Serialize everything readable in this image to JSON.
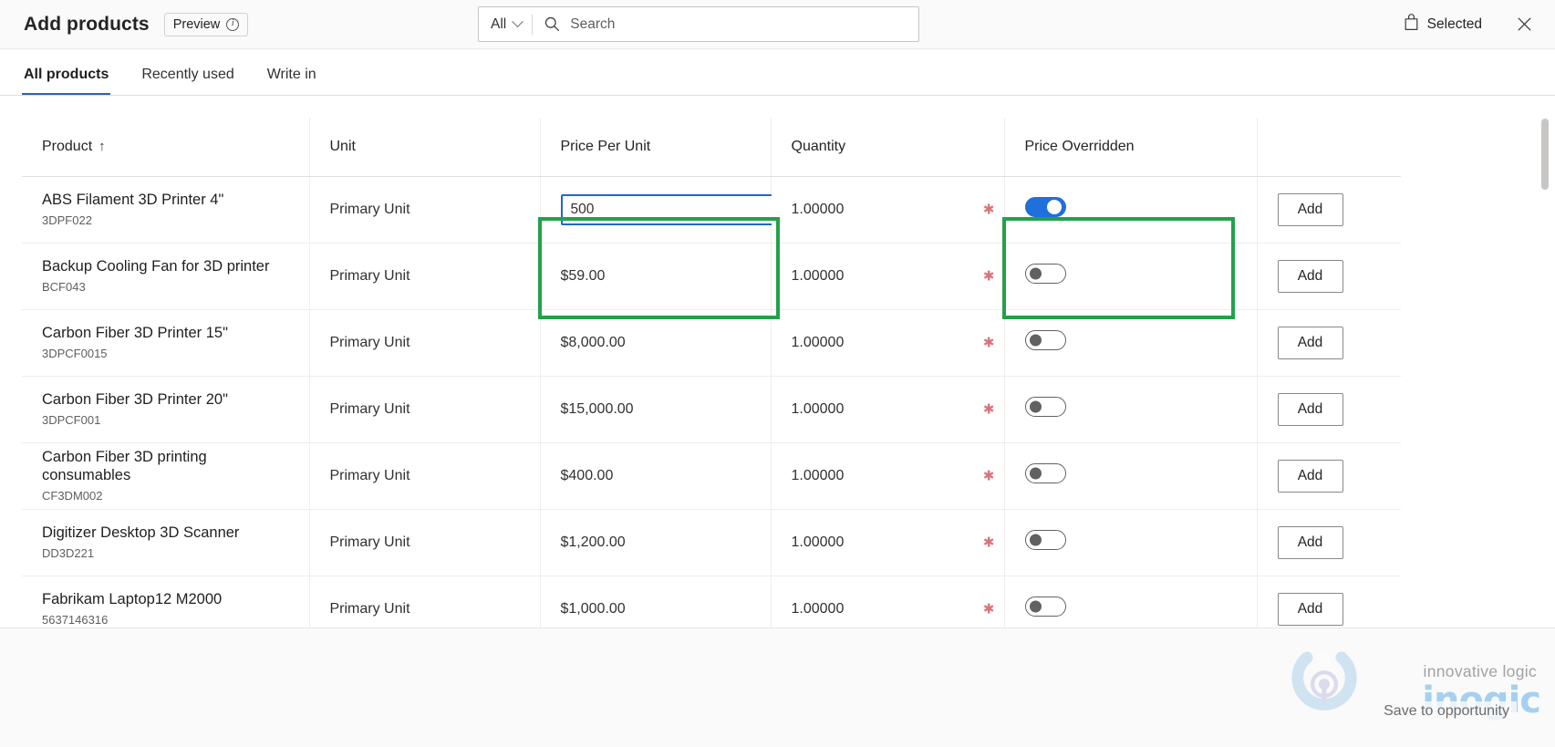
{
  "header": {
    "title": "Add products",
    "preview_label": "Preview",
    "info_icon": "info-icon",
    "selected_label": "Selected",
    "selected_icon": "shopping-bag-icon",
    "close_icon": "close-icon"
  },
  "search": {
    "scope_label": "All",
    "scope_chevron_icon": "chevron-down-icon",
    "icon": "search-icon",
    "placeholder": "Search",
    "value": ""
  },
  "tabs": [
    {
      "label": "All products",
      "active": true
    },
    {
      "label": "Recently used",
      "active": false
    },
    {
      "label": "Write in",
      "active": false
    }
  ],
  "table": {
    "columns": [
      {
        "key": "product",
        "label": "Product",
        "sort_icon": "sort-ascending-arrow-icon",
        "sorted": "asc"
      },
      {
        "key": "unit",
        "label": "Unit"
      },
      {
        "key": "price_per_unit",
        "label": "Price Per Unit"
      },
      {
        "key": "quantity",
        "label": "Quantity"
      },
      {
        "key": "price_overridden",
        "label": "Price Overridden"
      },
      {
        "key": "action",
        "label": ""
      }
    ],
    "rows": [
      {
        "name": "ABS Filament 3D Printer 4\"",
        "code": "3DPF022",
        "unit": "Primary Unit",
        "price_editing": true,
        "price_value": "500",
        "price": "",
        "quantity": "1.00000",
        "required": true,
        "overridden": true,
        "action_label": "Add"
      },
      {
        "name": "Backup Cooling Fan for 3D printer",
        "code": "BCF043",
        "unit": "Primary Unit",
        "price_editing": false,
        "price_value": "",
        "price": "$59.00",
        "quantity": "1.00000",
        "required": true,
        "overridden": false,
        "action_label": "Add"
      },
      {
        "name": "Carbon Fiber 3D Printer 15\"",
        "code": "3DPCF0015",
        "unit": "Primary Unit",
        "price_editing": false,
        "price_value": "",
        "price": "$8,000.00",
        "quantity": "1.00000",
        "required": true,
        "overridden": false,
        "action_label": "Add"
      },
      {
        "name": "Carbon Fiber 3D Printer 20\"",
        "code": "3DPCF001",
        "unit": "Primary Unit",
        "price_editing": false,
        "price_value": "",
        "price": "$15,000.00",
        "quantity": "1.00000",
        "required": true,
        "overridden": false,
        "action_label": "Add"
      },
      {
        "name": "Carbon Fiber 3D printing consumables",
        "code": "CF3DM002",
        "unit": "Primary Unit",
        "price_editing": false,
        "price_value": "",
        "price": "$400.00",
        "quantity": "1.00000",
        "required": true,
        "overridden": false,
        "action_label": "Add"
      },
      {
        "name": "Digitizer Desktop 3D Scanner",
        "code": "DD3D221",
        "unit": "Primary Unit",
        "price_editing": false,
        "price_value": "",
        "price": "$1,200.00",
        "quantity": "1.00000",
        "required": true,
        "overridden": false,
        "action_label": "Add"
      },
      {
        "name": "Fabrikam Laptop12 M2000",
        "code": "5637146316",
        "unit": "Primary Unit",
        "price_editing": false,
        "price_value": "",
        "price": "$1,000.00",
        "quantity": "1.00000",
        "required": true,
        "overridden": false,
        "action_label": "Add"
      }
    ]
  },
  "watermark": {
    "tagline": "innovative logic",
    "brand": "inogic",
    "save_label": "Save to opportunity"
  },
  "highlights": [
    {
      "name": "price-per-unit-column-highlight",
      "color": "#22a14a"
    },
    {
      "name": "price-overridden-column-highlight",
      "color": "#22a14a"
    }
  ],
  "colors": {
    "accent": "#2266bb",
    "toggle_on": "#1f6fdd",
    "highlight": "#22a14a",
    "required_star": "#d9737a"
  }
}
